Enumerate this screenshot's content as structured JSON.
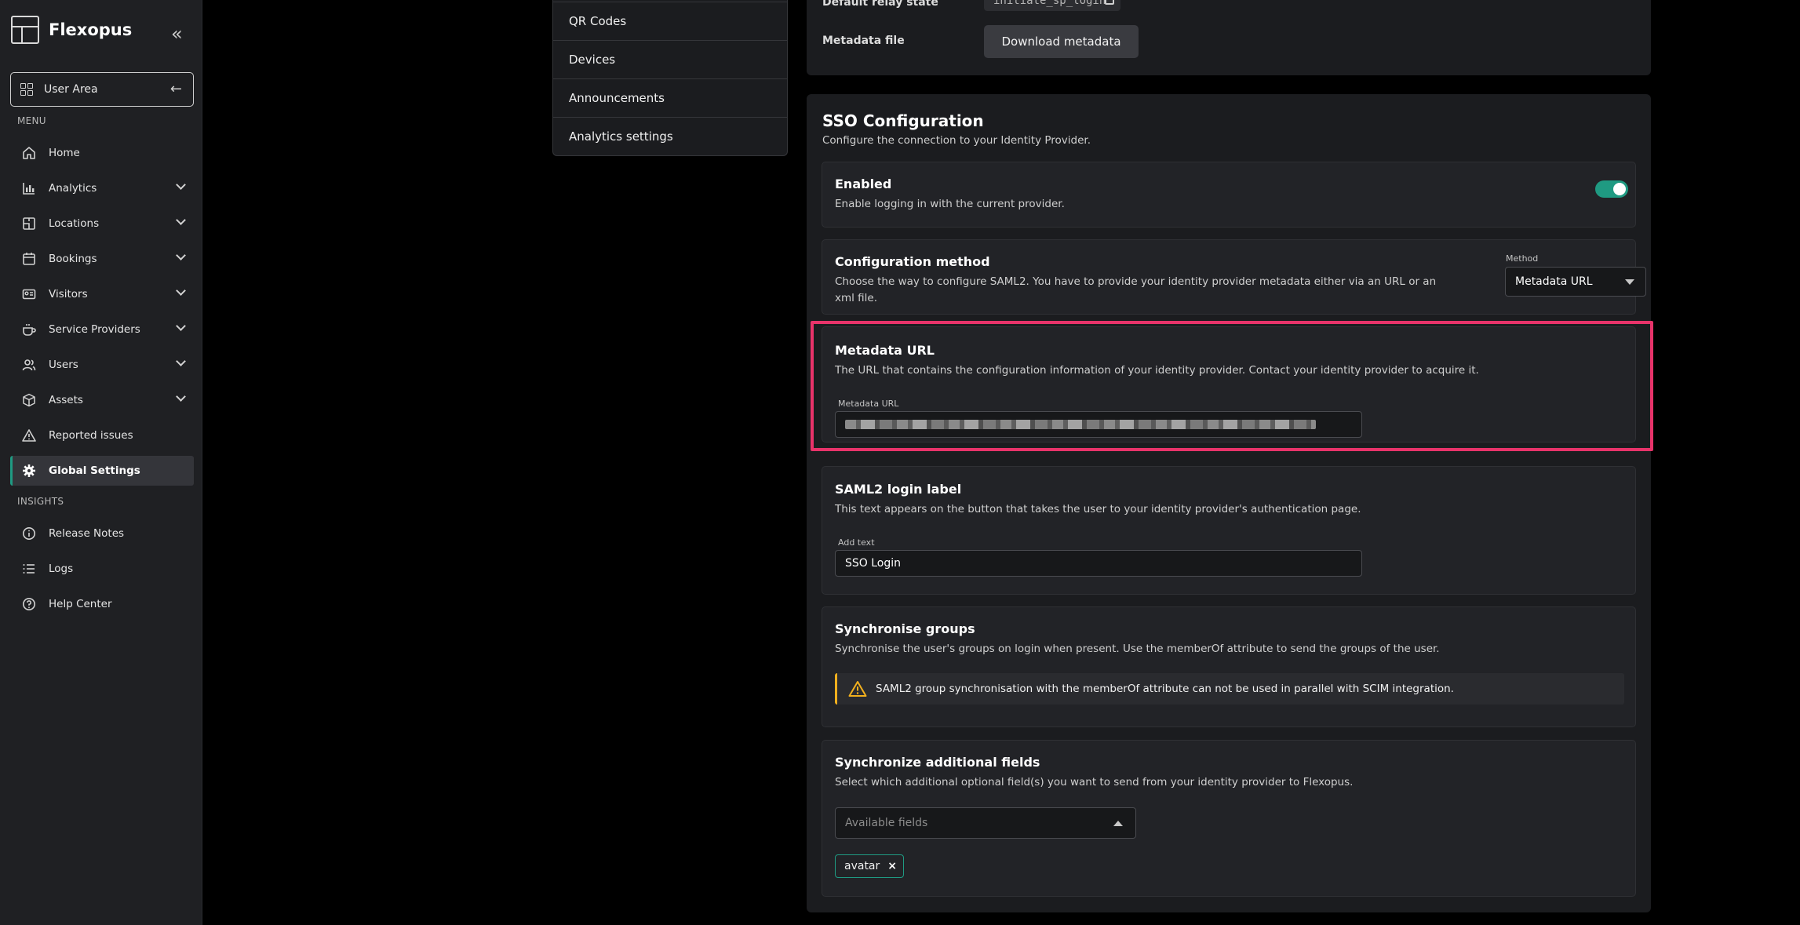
{
  "brand": {
    "name": "Flexopus"
  },
  "user_area": {
    "label": "User Area"
  },
  "sidebar": {
    "menu_label": "MENU",
    "insights_label": "INSIGHTS",
    "items": [
      {
        "label": "Home",
        "icon": "home-icon"
      },
      {
        "label": "Analytics",
        "icon": "bar-chart-icon"
      },
      {
        "label": "Locations",
        "icon": "map-icon"
      },
      {
        "label": "Bookings",
        "icon": "calendar-icon"
      },
      {
        "label": "Visitors",
        "icon": "id-card-icon"
      },
      {
        "label": "Service Providers",
        "icon": "coffee-icon"
      },
      {
        "label": "Users",
        "icon": "users-icon"
      },
      {
        "label": "Assets",
        "icon": "box-icon"
      },
      {
        "label": "Reported issues",
        "icon": "warning-icon"
      },
      {
        "label": "Global Settings",
        "icon": "gear-icon"
      }
    ],
    "insights": [
      {
        "label": "Release Notes",
        "icon": "info-icon"
      },
      {
        "label": "Logs",
        "icon": "list-icon"
      },
      {
        "label": "Help Center",
        "icon": "help-icon"
      }
    ]
  },
  "submenu": {
    "items": [
      "QR Codes",
      "Devices",
      "Announcements",
      "Analytics settings"
    ]
  },
  "top_panel": {
    "relay_label": "Default relay state",
    "relay_value": "initiate_sp_login",
    "metadata_file_label": "Metadata file",
    "download_button": "Download metadata"
  },
  "sso": {
    "title": "SSO Configuration",
    "subtitle": "Configure the connection to your Identity Provider.",
    "enabled": {
      "title": "Enabled",
      "desc": "Enable logging in with the current provider.",
      "on": true
    },
    "config_method": {
      "title": "Configuration method",
      "desc": "Choose the way to configure SAML2. You have to provide your identity provider metadata either via an URL or an xml file.",
      "select_label": "Method",
      "select_value": "Metadata URL"
    },
    "metadata_url": {
      "title": "Metadata URL",
      "desc": "The URL that contains the configuration information of your identity provider. Contact your identity provider to acquire it.",
      "field_label": "Metadata URL"
    },
    "login_label": {
      "title": "SAML2 login label",
      "desc": "This text appears on the button that takes the user to your identity provider's authentication page.",
      "field_label": "Add text",
      "value": "SSO Login"
    },
    "sync_groups": {
      "title": "Synchronise groups",
      "desc": "Synchronise the user's groups on login when present. Use the memberOf attribute to send the groups of the user.",
      "warning": "SAML2 group synchronisation with the memberOf attribute can not be used in parallel with SCIM integration."
    },
    "sync_fields": {
      "title": "Synchronize additional fields",
      "desc": "Select which additional optional field(s) you want to send from your identity provider to Flexopus.",
      "placeholder": "Available fields",
      "chip": "avatar",
      "chip_remove": "×"
    }
  },
  "colors": {
    "accent": "#1f9a82",
    "highlight": "#e8336a",
    "warning": "#f2b01e"
  }
}
